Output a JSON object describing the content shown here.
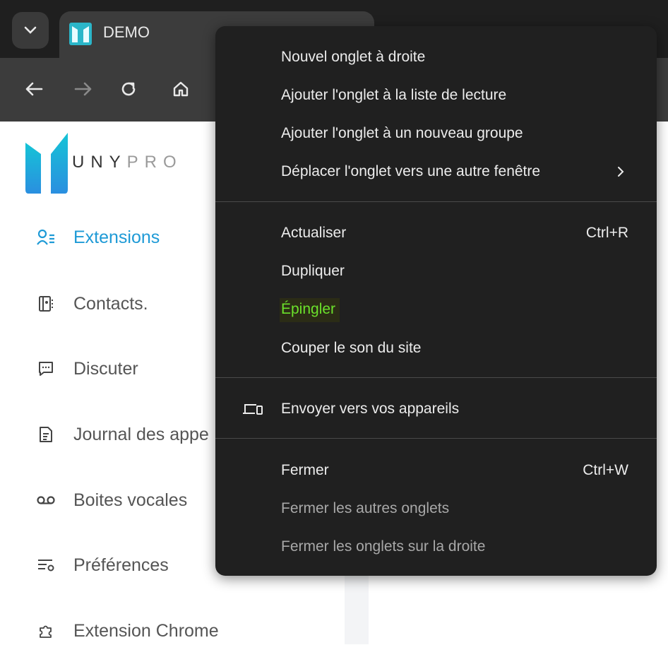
{
  "browser": {
    "tab_title": "DEMO"
  },
  "sidebar": {
    "logo_text_dark": "UNY",
    "logo_text_light": "PRO",
    "items": [
      {
        "label": "Extensions",
        "icon": "user-list-icon",
        "active": true
      },
      {
        "label": "Contacts.",
        "icon": "address-book-icon"
      },
      {
        "label": "Discuter",
        "icon": "chat-icon"
      },
      {
        "label": "Journal des appe",
        "icon": "call-log-icon"
      },
      {
        "label": "Boites vocales",
        "icon": "voicemail-icon"
      },
      {
        "label": "Préférences",
        "icon": "settings-list-icon"
      },
      {
        "label": "Extension Chrome",
        "icon": "puzzle-icon"
      }
    ]
  },
  "context_menu": {
    "items": [
      {
        "label": "Nouvel onglet à droite"
      },
      {
        "label": "Ajouter l'onglet à la liste de lecture"
      },
      {
        "label": "Ajouter l'onglet à un nouveau groupe"
      },
      {
        "label": "Déplacer l'onglet vers une autre fenêtre",
        "submenu": true
      },
      {
        "label": "Actualiser",
        "shortcut": "Ctrl+R"
      },
      {
        "label": "Dupliquer"
      },
      {
        "label": "Épingler",
        "highlighted": true
      },
      {
        "label": "Couper le son du site"
      },
      {
        "label": "Envoyer vers vos appareils",
        "icon": "devices-icon"
      },
      {
        "label": "Fermer",
        "shortcut": "Ctrl+W"
      },
      {
        "label": "Fermer les autres onglets",
        "disabled": true
      },
      {
        "label": "Fermer les onglets sur la droite",
        "disabled": true
      }
    ]
  },
  "colors": {
    "accent": "#1e9ad6",
    "highlight_text": "#6be12b",
    "menu_bg": "#202020"
  }
}
